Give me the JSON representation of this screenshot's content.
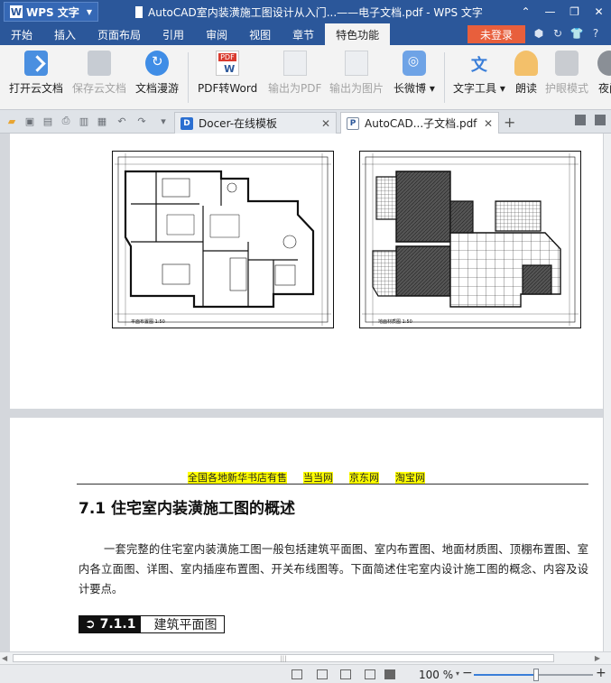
{
  "app": {
    "menu_button": "WPS 文字",
    "window_title": "AutoCAD室内装潢施工图设计从入门...——电子文档.pdf - WPS 文字"
  },
  "menu": {
    "tabs": [
      "开始",
      "插入",
      "页面布局",
      "引用",
      "审阅",
      "视图",
      "章节",
      "特色功能"
    ],
    "active": "特色功能",
    "login": "未登录"
  },
  "ribbon": {
    "open_cloud": "打开云文档",
    "save_cloud": "保存云文档",
    "cloud_roam": "文档漫游",
    "pdf_to_word": "PDF转Word",
    "export_pdf": "输出为PDF",
    "export_image": "输出为图片",
    "weibo": "长微博",
    "text_tools": "文字工具",
    "read_aloud": "朗读",
    "eye_mode": "护眼模式",
    "night": "夜间"
  },
  "tabs": {
    "docer": "Docer-在线模板",
    "current": "AutoCAD...子文档.pdf"
  },
  "document": {
    "booksellers": [
      "全国各地新华书店有售",
      "当当网",
      "京东网",
      "淘宝网"
    ],
    "section_title": "7.1  住宅室内装潢施工图的概述",
    "paragraph": "一套完整的住宅室内装潢施工图一般包括建筑平面图、室内布置图、地面材质图、顶棚布置图、室内各立面图、详图、室内插座布置图、开关布线图等。下面简述住宅室内设计施工图的概念、内容及设计要点。",
    "subsection_number": "➲ 7.1.1",
    "subsection_title": "建筑平面图"
  },
  "status": {
    "zoom": "100 %",
    "zoom_fraction": 0.52
  },
  "colors": {
    "title_bar": "#2b579a",
    "login_button": "#e85f3c",
    "highlight": "#ffff00"
  }
}
